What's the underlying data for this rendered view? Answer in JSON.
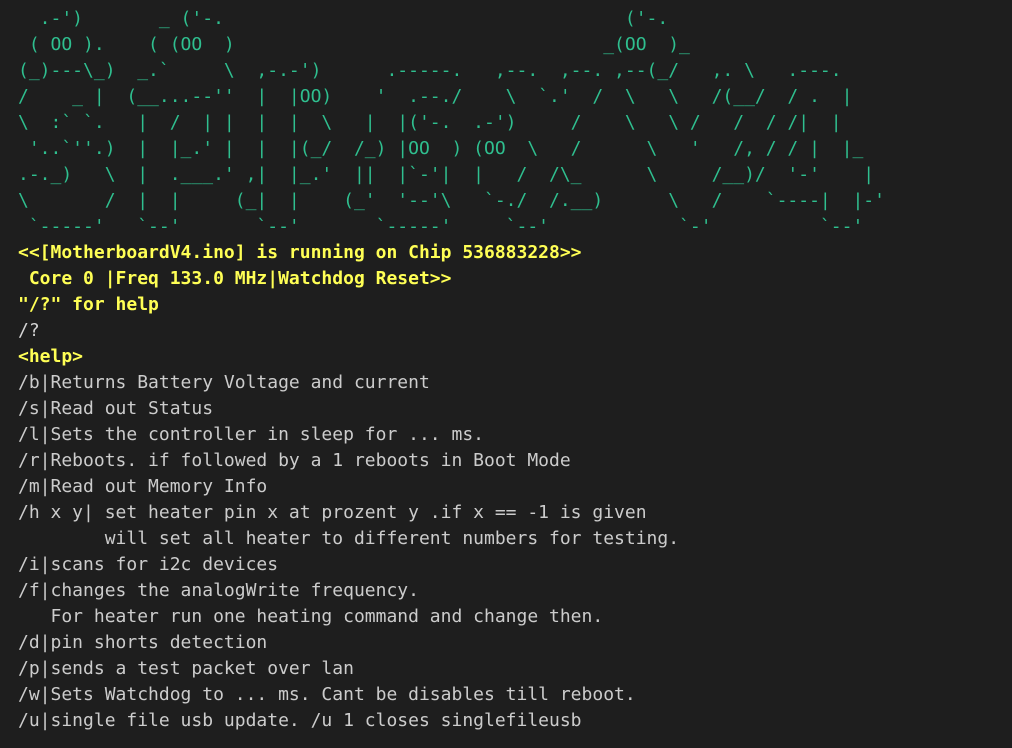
{
  "banner": {
    "lines": [
      "  .-')       _ ('-.                                     ('-.                ",
      " ( OO ).    ( (OO  )                                  _(OO  )_              ",
      "(_)---\\_)  _.`     \\  ,-.-')      .-----.   ,--.  ,--. ,--(_/   ,. \\   .---. ",
      "/    _ |  (__...--''  |  |OO)    '  .--./    \\  `.'  /  \\   \\   /(__/  / .  | ",
      "\\  :` `.   |  /  | |  |  |  \\   |  |('-.  .-')     /    \\   \\ /   /  / /|  | ",
      " '..`''.)  |  |_.' |  |  |(_/  /_) |OO  ) (OO  \\   /      \\   '   /, / / |  |_ ",
      ".-._)   \\  |  .___.' ,|  |_.'  ||  |`-'|  |   /  /\\_      \\     /__)/  '-'    |",
      "\\       /  |  |     (_|  |    (_'  '--'\\   `-./  /.__)      \\   /    `----|  |-'",
      " `-----'   `--'       `--'       `-----'     `--'            `-'          `--'  "
    ]
  },
  "status": {
    "running": "<<[MotherboardV4.ino] is running on Chip 536883228>>",
    "core": " Core 0 |Freq 133.0 MHz|Watchdog Reset>>",
    "hint": "\"/?\" for help"
  },
  "input": {
    "command": "/?"
  },
  "help": {
    "tag": "<help>",
    "lines": [
      "/b|Returns Battery Voltage and current",
      "/s|Read out Status",
      "/l|Sets the controller in sleep for ... ms.",
      "/r|Reboots. if followed by a 1 reboots in Boot Mode",
      "/m|Read out Memory Info",
      "/h x y| set heater pin x at prozent y .if x == -1 is given",
      "        will set all heater to different numbers for testing.",
      "/i|scans for i2c devices",
      "/f|changes the analogWrite frequency.",
      "   For heater run one heating command and change then.",
      "/d|pin shorts detection",
      "/p|sends a test packet over lan",
      "/w|Sets Watchdog to ... ms. Cant be disables till reboot.",
      "/u|single file usb update. /u 1 closes singlefileusb"
    ]
  }
}
